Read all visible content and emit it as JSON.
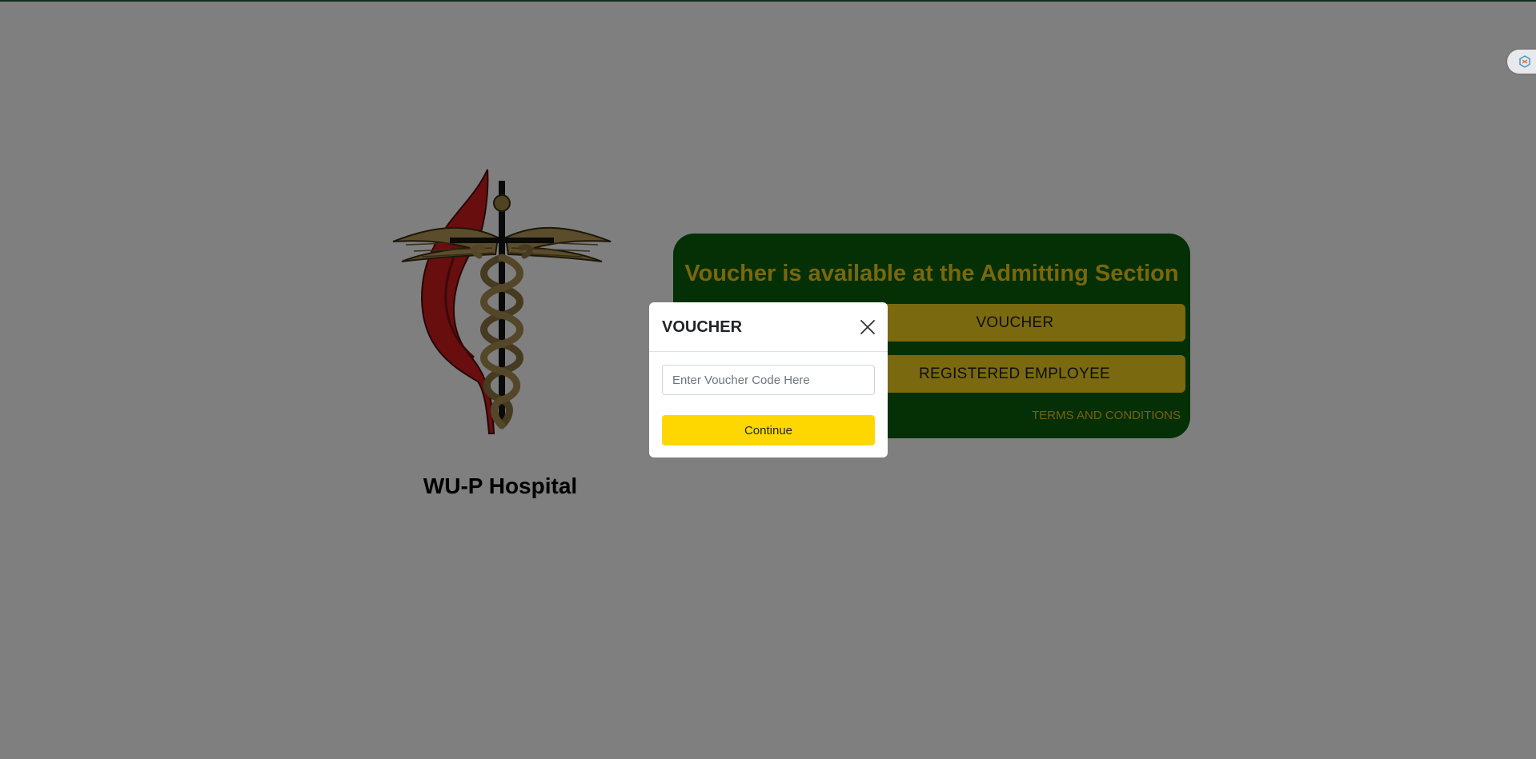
{
  "branding": {
    "hospital_name": "WU-P Hospital"
  },
  "card": {
    "title": "Voucher is available at the Admitting Section",
    "voucher_button_label": "VOUCHER",
    "employee_button_label": "REGISTERED EMPLOYEE",
    "terms_link_label": "TERMS AND CONDITIONS"
  },
  "modal": {
    "title": "VOUCHER",
    "voucher_input_placeholder": "Enter Voucher Code Here",
    "voucher_input_value": "",
    "continue_label": "Continue"
  },
  "colors": {
    "card_bg": "#0a5f0a",
    "card_title": "#f4cf1b",
    "button_yellow": "#f7d21e",
    "continue_yellow": "#ffd700",
    "top_accent": "#1f5f3a"
  },
  "icons": {
    "logo": "caduceus-cross-flame-logo",
    "close": "close-icon",
    "extension": "extension-icon"
  }
}
